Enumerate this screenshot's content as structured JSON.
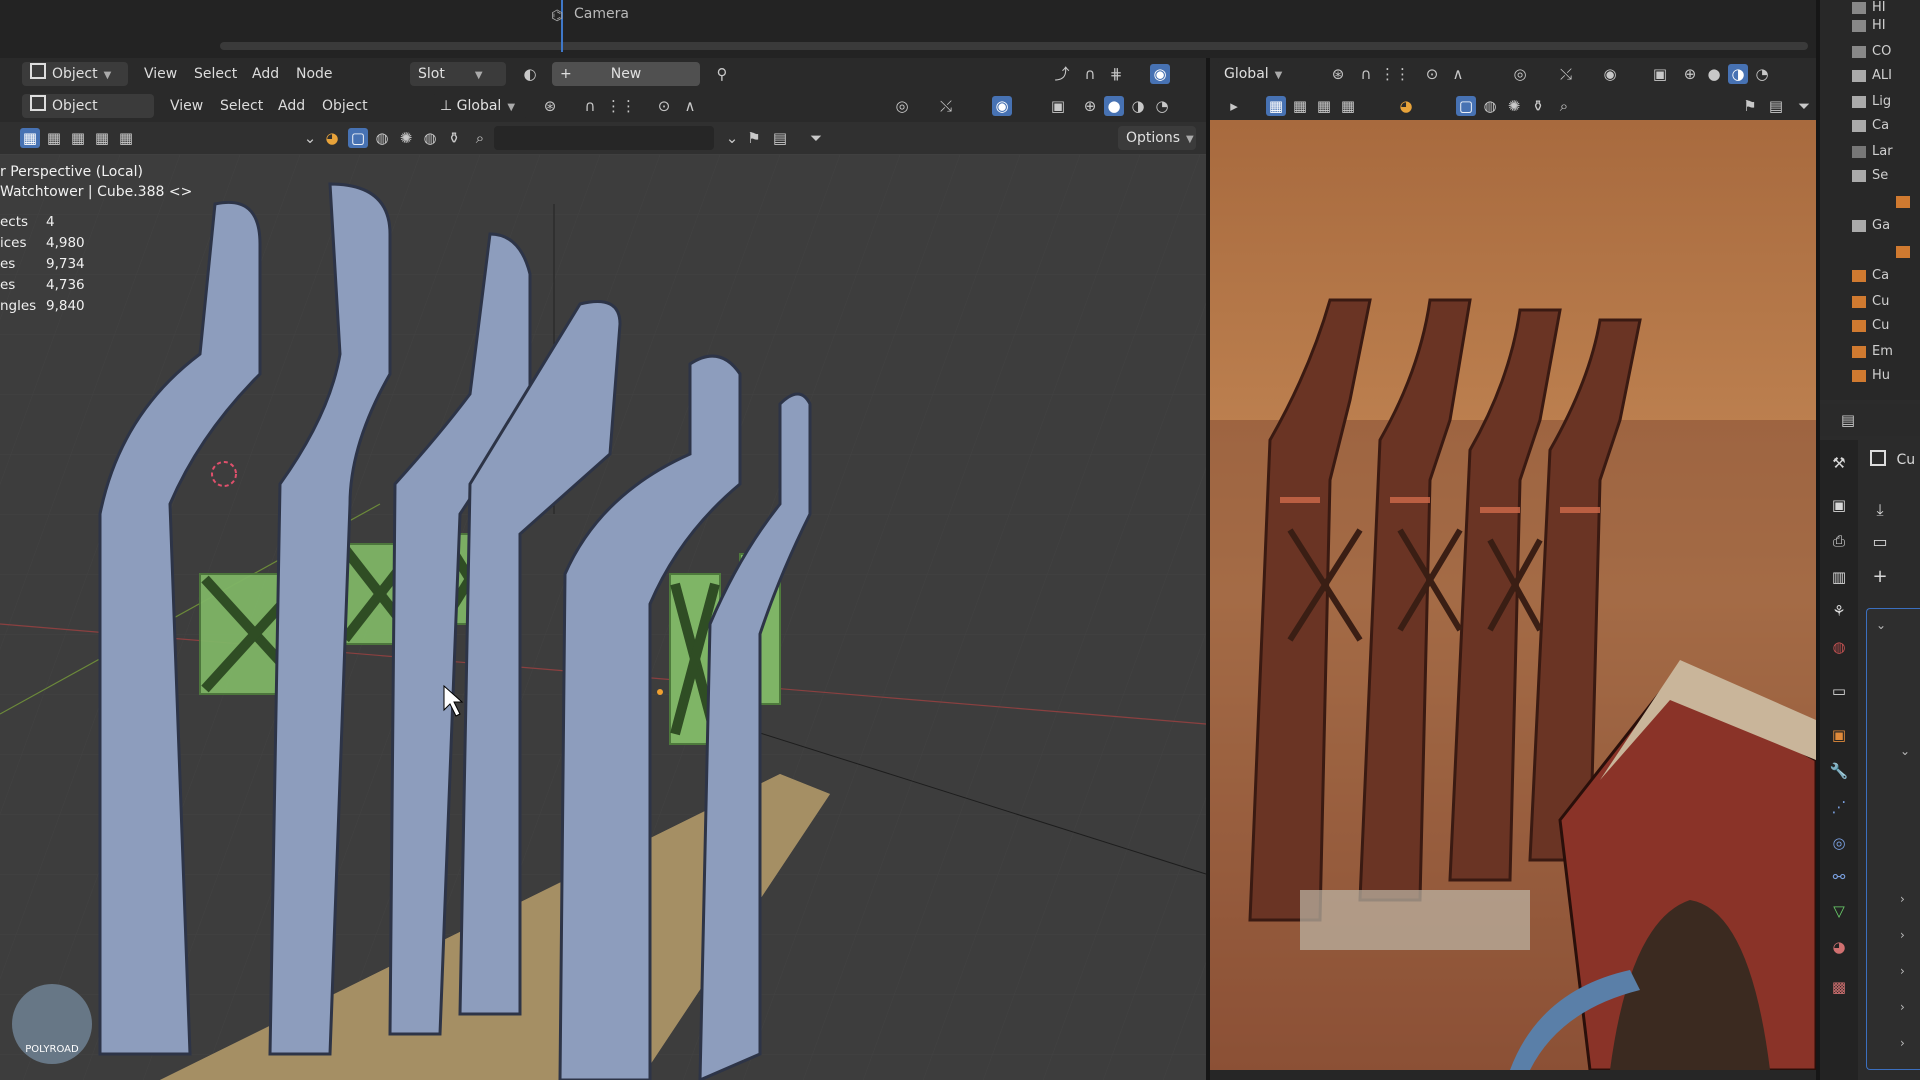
{
  "timeline": {
    "camera_label": "Camera"
  },
  "shader_header": {
    "mode": "Object",
    "menus": [
      "View",
      "Select",
      "Add",
      "Node"
    ],
    "slot": "Slot",
    "new_button": "New"
  },
  "viewport_header": {
    "mode": "Object Mode",
    "menus": [
      "View",
      "Select",
      "Add",
      "Object"
    ],
    "transform_orientation": "Global",
    "options": "Options"
  },
  "render_header": {
    "transform_orientation": "Global"
  },
  "viewport": {
    "perspective_label": "r Perspective (Local)",
    "object_label": "Watchtower | Cube.388 <>",
    "stats": [
      {
        "label": "ects",
        "value": "4"
      },
      {
        "label": "ices",
        "value": "4,980"
      },
      {
        "label": "es",
        "value": "9,734"
      },
      {
        "label": "es",
        "value": "4,736"
      },
      {
        "label": "ngles",
        "value": "9,840"
      }
    ],
    "logo_text": "POLYROAD"
  },
  "outliner": {
    "items": [
      "HI",
      "HI",
      "CO",
      "ALI",
      "Lig",
      "Ca",
      "Lar",
      "Se",
      "",
      "Ga",
      "",
      "Ca",
      "Cu",
      "Cu",
      "Em",
      "Hu"
    ]
  },
  "properties": {
    "object_name": "Cu"
  },
  "colors": {
    "accent": "#4772b3",
    "arch": "#8d9dbd",
    "brace": "#7fb566",
    "ground": "#b39b6e"
  }
}
